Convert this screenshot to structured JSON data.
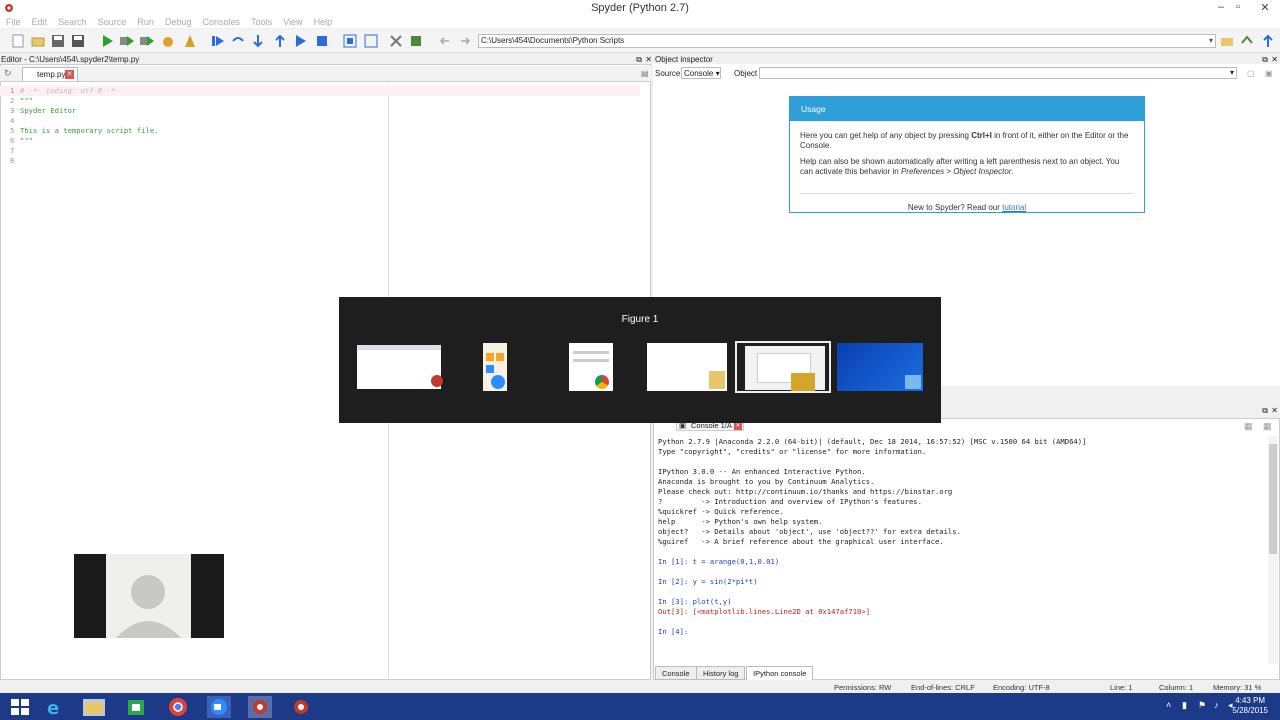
{
  "window": {
    "title": "Spyder (Python 2.7)",
    "minimize": "–",
    "maximize": "▫",
    "close": "✕"
  },
  "menu": [
    "File",
    "Edit",
    "Search",
    "Source",
    "Run",
    "Debug",
    "Consoles",
    "Tools",
    "View",
    "Help"
  ],
  "toolbar": {
    "path": "C:\\Users\\454\\Documents\\Python Scripts"
  },
  "editor": {
    "header": "Editor - C:\\Users\\454\\.spyder2\\temp.py",
    "tab": "temp.py",
    "lines": [
      {
        "n": "1",
        "text": "# -*- coding: utf-8 -*-"
      },
      {
        "n": "2",
        "text": "\"\"\""
      },
      {
        "n": "3",
        "text": "Spyder Editor"
      },
      {
        "n": "4",
        "text": ""
      },
      {
        "n": "5",
        "text": "This is a temporary script file."
      },
      {
        "n": "6",
        "text": "\"\"\""
      },
      {
        "n": "7",
        "text": ""
      },
      {
        "n": "8",
        "text": ""
      }
    ]
  },
  "inspector": {
    "header": "Object inspector",
    "source_label": "Source",
    "source_value": "Console",
    "object_label": "Object",
    "usage_title": "Usage",
    "usage_p1a": "Here you can get help of any object by pressing ",
    "usage_p1b": "Ctrl+I",
    "usage_p1c": " in front of it, either on the Editor or the Console.",
    "usage_p2a": "Help can also be shown automatically after writing a left parenthesis next to an object. You can activate this behavior in ",
    "usage_p2b": "Preferences > Object Inspector",
    "usage_p2c": ".",
    "new_to": "New to Spyder? Read our ",
    "tutorial": "tutorial"
  },
  "switcher": {
    "title": "Figure 1"
  },
  "console": {
    "tab": "Console 1/A",
    "lines": [
      "Python 2.7.9 |Anaconda 2.2.0 (64-bit)| (default, Dec 18 2014, 16:57:52) [MSC v.1500 64 bit (AMD64)]",
      "Type \"copyright\", \"credits\" or \"license\" for more information.",
      "",
      "IPython 3.0.0 -- An enhanced Interactive Python.",
      "Anaconda is brought to you by Continuum Analytics.",
      "Please check out: http://continuum.io/thanks and https://binstar.org",
      "?         -> Introduction and overview of IPython's features.",
      "%quickref -> Quick reference.",
      "help      -> Python's own help system.",
      "object?   -> Details about 'object', use 'object??' for extra details.",
      "%guiref   -> A brief reference about the graphical user interface.",
      "",
      "In [1]: t = arange(0,1,0.01)",
      "",
      "In [2]: y = sin(2*pi*t)",
      "",
      "In [3]: plot(t,y)",
      "Out[3]: [<matplotlib.lines.Line2D at 0x147af710>]",
      "",
      "In [4]:"
    ],
    "bottom_tabs": [
      "Console",
      "History log",
      "IPython console"
    ]
  },
  "status": {
    "permissions": "Permissions: RW",
    "eol": "End-of-lines: CRLF",
    "encoding": "Encoding: UTF-8",
    "line": "Line: 1",
    "column": "Column: 1",
    "memory": "Memory: 31 %"
  },
  "clock": {
    "time": "4:43 PM",
    "date": "5/28/2015"
  },
  "colors": {
    "accent": "#2e9fd8",
    "taskbar": "#1d3a88",
    "code": "#3a9a3a"
  }
}
